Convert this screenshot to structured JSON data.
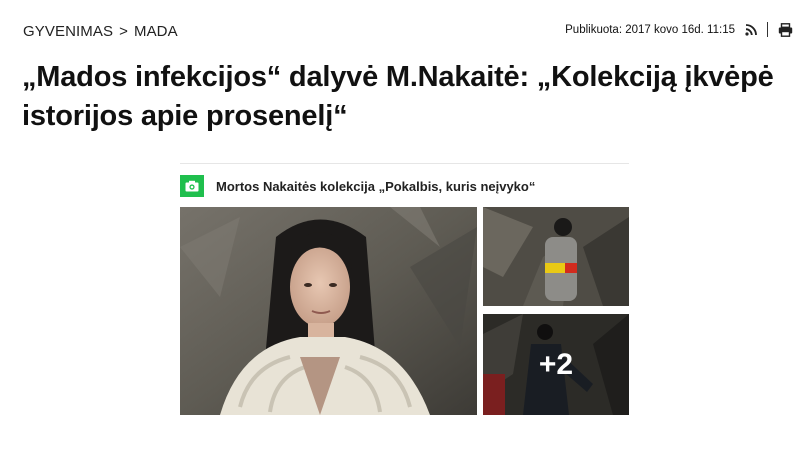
{
  "breadcrumb": {
    "section": "GYVENIMAS",
    "separator": ">",
    "subsection": "MADA"
  },
  "meta": {
    "published": "Publikuota: 2017 kovo 16d. 11:15",
    "icons": [
      "rss-icon",
      "print-icon"
    ]
  },
  "article": {
    "title": "„Mados infekcijos“ dalyvė M.Nakaitė: „Kolekciją įkvėpė istorijos apie prosenelį“"
  },
  "gallery": {
    "title": "Mortos Nakaitės kolekcija „Pokalbis, kuris neįvyko“",
    "more_count": "+2",
    "colors": {
      "accent": "#1fbf4d",
      "backdrop": "#6f6b60",
      "backdrop_dark": "#3b3a35"
    }
  }
}
